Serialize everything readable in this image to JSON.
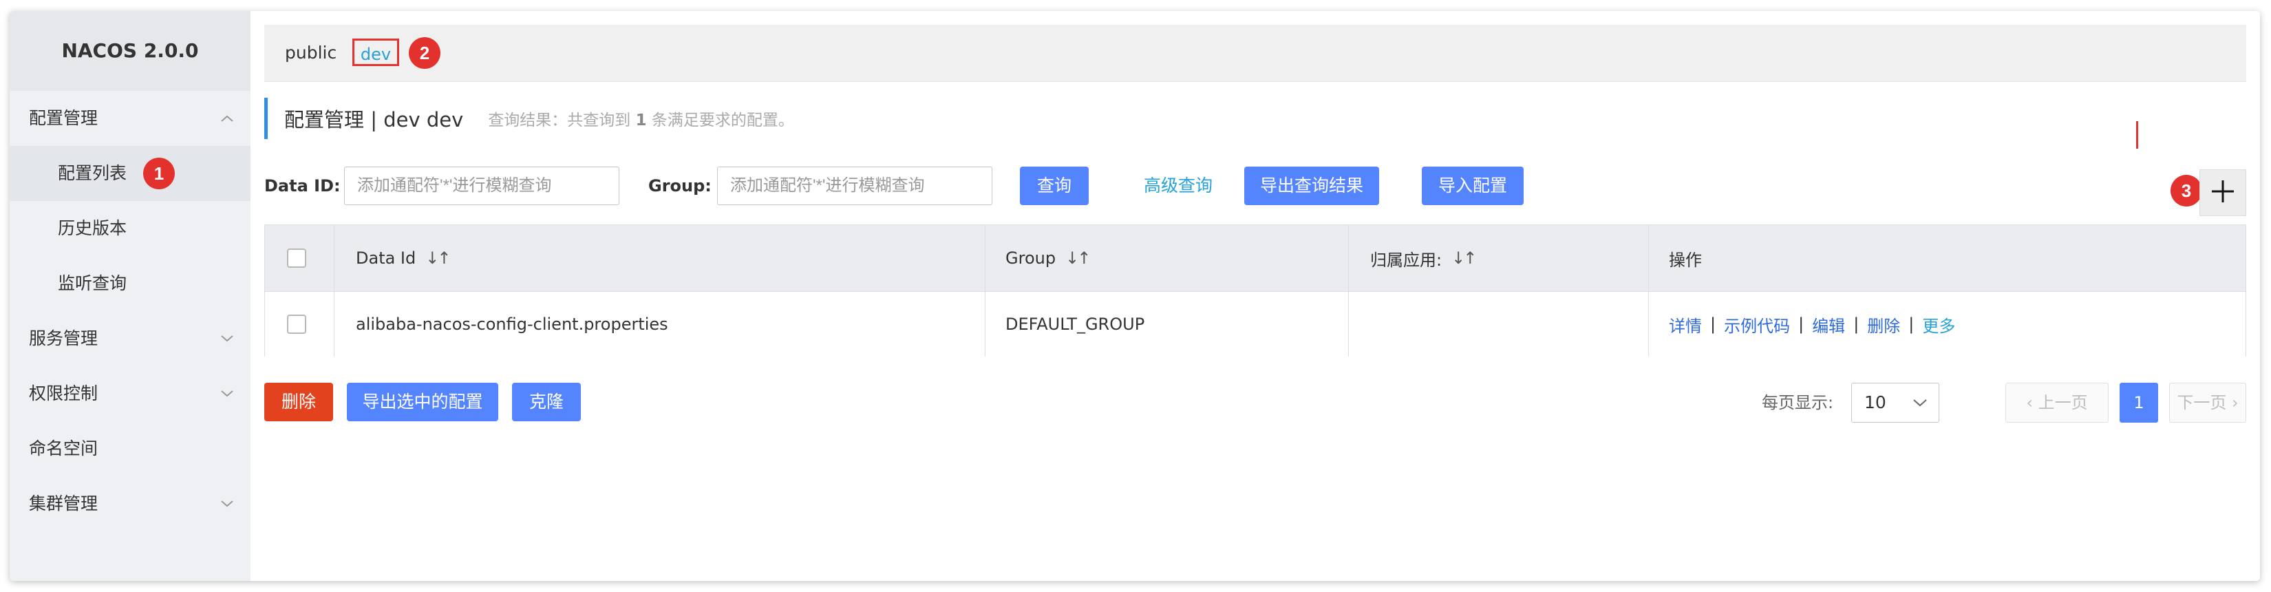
{
  "app": {
    "title": "NACOS 2.0.0"
  },
  "sidebar": {
    "items": [
      {
        "label": "配置管理",
        "expanded": true
      },
      {
        "label": "配置列表",
        "active": true
      },
      {
        "label": "历史版本"
      },
      {
        "label": "监听查询"
      },
      {
        "label": "服务管理"
      },
      {
        "label": "权限控制"
      },
      {
        "label": "命名空间"
      },
      {
        "label": "集群管理"
      }
    ]
  },
  "annotations": {
    "m1": "1",
    "m2": "2",
    "m3": "3"
  },
  "namespaces": {
    "public": "public",
    "dev": "dev"
  },
  "header": {
    "title": "配置管理 | dev dev",
    "result_prefix": "查询结果：共查询到",
    "result_count": "1",
    "result_suffix": "条满足要求的配置。"
  },
  "search": {
    "dataid_label": "Data ID:",
    "dataid_placeholder": "添加通配符'*'进行模糊查询",
    "group_label": "Group:",
    "group_placeholder": "添加通配符'*'进行模糊查询",
    "query_btn": "查询",
    "advanced_link": "高级查询",
    "export_btn": "导出查询结果",
    "import_btn": "导入配置"
  },
  "table": {
    "columns": [
      "Data Id",
      "Group",
      "归属应用:",
      "操作"
    ],
    "rows": [
      {
        "data_id": "alibaba-nacos-config-client.properties",
        "group": "DEFAULT_GROUP",
        "app": "",
        "ops": [
          "详情",
          "示例代码",
          "编辑",
          "删除",
          "更多"
        ]
      }
    ]
  },
  "footer": {
    "delete_btn": "删除",
    "export_selected_btn": "导出选中的配置",
    "clone_btn": "克隆",
    "page_size_label": "每页显示:",
    "page_size": "10",
    "prev": "上一页",
    "page": "1",
    "next": "下一页"
  },
  "colors": {
    "primary": "#5584ff",
    "danger": "#e3421e",
    "marker": "#e3322e",
    "link": "#27a2d8"
  }
}
